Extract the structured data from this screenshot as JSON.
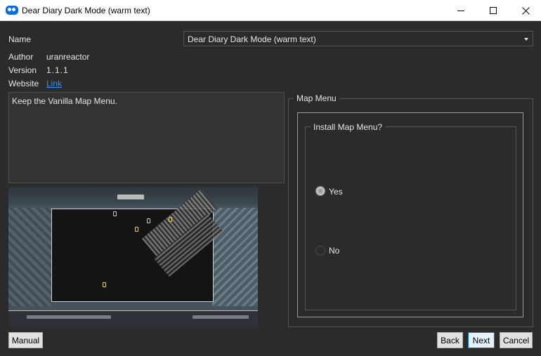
{
  "window": {
    "title": "Dear Diary Dark Mode (warm text)",
    "icon": "app-logo-icon",
    "controls": {
      "minimize": "minimize-icon",
      "maximize": "maximize-icon",
      "close": "close-icon"
    }
  },
  "info": {
    "name_label": "Name",
    "name_value": "Dear Diary Dark Mode (warm text)",
    "author_label": "Author",
    "author_value": "uranreactor",
    "version_label": "Version",
    "version_value": "1.1.1",
    "website_label": "Website",
    "website_link": "Link"
  },
  "description": "Keep the Vanilla Map Menu.",
  "group": {
    "title": "Map Menu",
    "inner_title": "Install Map Menu?",
    "options": [
      {
        "label": "Yes",
        "selected": true
      },
      {
        "label": "No",
        "selected": false
      }
    ]
  },
  "buttons": {
    "manual": "Manual",
    "back": "Back",
    "next": "Next",
    "cancel": "Cancel"
  },
  "colors": {
    "background": "#2b2b2b",
    "text": "#e6e6e6",
    "link": "#3b8eea",
    "focus_border": "#0078d7"
  }
}
